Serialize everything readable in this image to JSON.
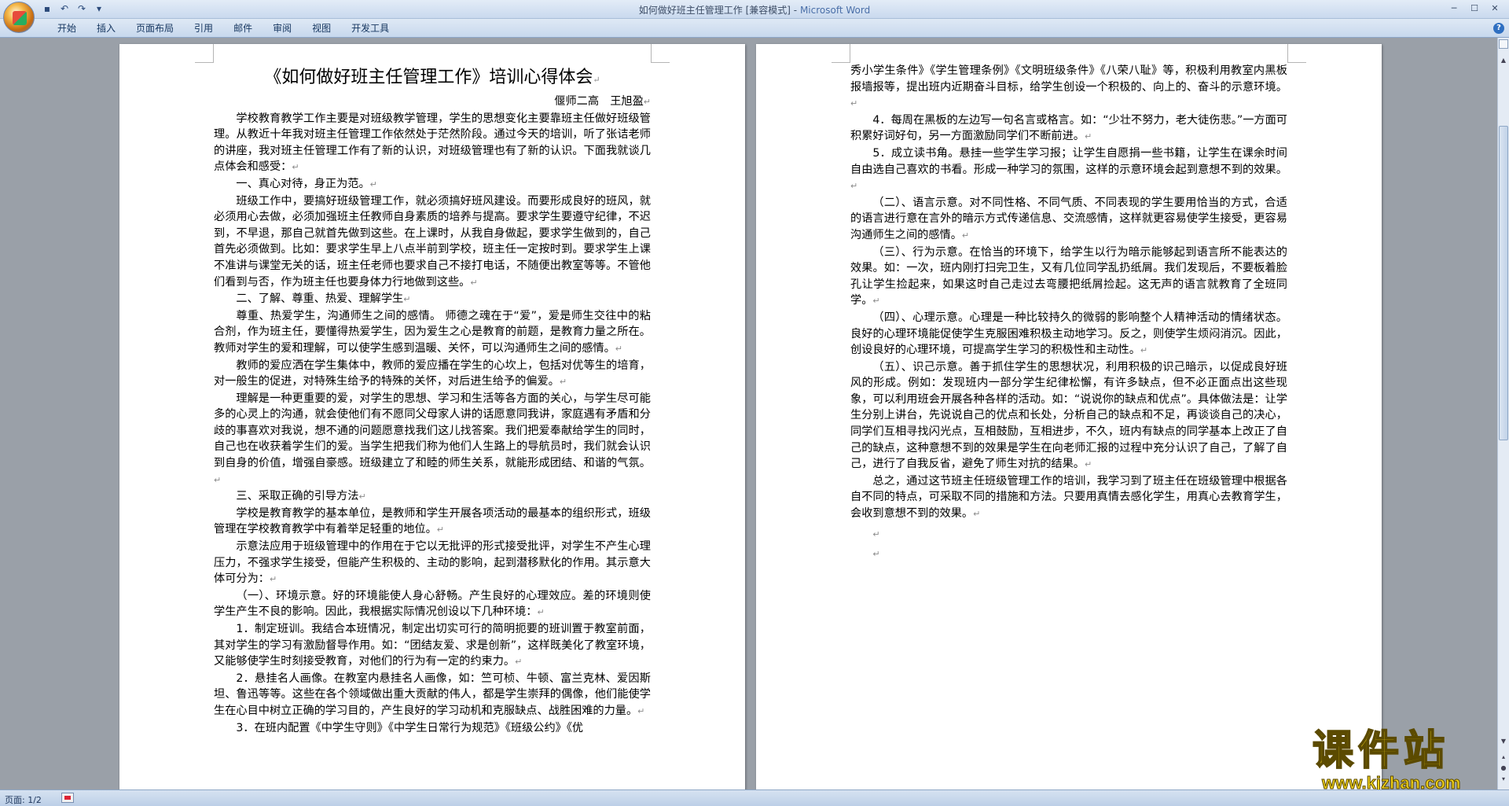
{
  "window": {
    "title": "如何做好班主任管理工作 [兼容模式]",
    "app_name": "Microsoft Word",
    "separator": " - "
  },
  "quick_access": [
    "save-icon",
    "undo-icon",
    "redo-icon",
    "customize-icon"
  ],
  "ribbon": {
    "tabs": [
      "开始",
      "插入",
      "页面布局",
      "引用",
      "邮件",
      "审阅",
      "视图",
      "开发工具"
    ]
  },
  "document": {
    "title": "《如何做好班主任管理工作》培训心得体会",
    "author": "偃师二高　王旭盈",
    "page1": [
      "学校教育教学工作主要是对班级教学管理，学生的思想变化主要靠班主任做好班级管理。从教近十年我对班主任管理工作依然处于茫然阶段。通过今天的培训，听了张诘老师的讲座，我对班主任管理工作有了新的认识，对班级管理也有了新的认识。下面我就谈几点体会和感受：",
      "一、真心对待，身正为范。",
      "班级工作中，要搞好班级管理工作，就必须搞好班风建设。而要形成良好的班风，就必须用心去做，必须加强班主任教师自身素质的培养与提高。要求学生要遵守纪律，不迟到，不早退，那自己就首先做到这些。在上课时，从我自身做起，要求学生做到的，自己首先必须做到。比如：要求学生早上八点半前到学校，班主任一定按时到。要求学生上课不准讲与课堂无关的话，班主任老师也要求自己不接打电话，不随便出教室等等。不管他们看到与否，作为班主任也要身体力行地做到这些。",
      "二、了解、尊重、热爱、理解学生",
      "尊重、热爱学生，沟通师生之间的感情。 师德之魂在于“爱”，爱是师生交往中的粘合剂，作为班主任，要懂得热爱学生，因为爱生之心是教育的前题，是教育力量之所在。教师对学生的爱和理解，可以使学生感到温暖、关怀，可以沟通师生之间的感情。",
      "教师的爱应洒在学生集体中，教师的爱应播在学生的心坎上，包括对优等生的培育，对一般生的促进，对特殊生给予的特殊的关怀，对后进生给予的偏爱。",
      "理解是一种更重要的爱，对学生的思想、学习和生活等各方面的关心，与学生尽可能多的心灵上的沟通，就会使他们有不愿同父母家人讲的话愿意同我讲，家庭遇有矛盾和分歧的事喜欢对我说，想不通的问题愿意找我们这儿找答案。我们把爱奉献给学生的同时，自己也在收获着学生们的爱。当学生把我们称为他们人生路上的导航员时，我们就会认识到自身的价值，增强自豪感。班级建立了和睦的师生关系，就能形成团结、和谐的气氛。",
      "三、采取正确的引导方法",
      "学校是教育教学的基本单位，是教师和学生开展各项活动的最基本的组织形式，班级管理在学校教育教学中有着举足轻重的地位。",
      "示意法应用于班级管理中的作用在于它以无批评的形式接受批评，对学生不产生心理压力，不强求学生接受，但能产生积极的、主动的影响，起到潜移默化的作用。其示意大体可分为：",
      "（一）、环境示意。好的环境能使人身心舒畅。产生良好的心理效应。差的环境则使学生产生不良的影响。因此，我根据实际情况创设以下几种环境：",
      "1．制定班训。我结合本班情况，制定出切实可行的简明扼要的班训置于教室前面，其对学生的学习有激励督导作用。如：“团结友爱、求是创新”，这样既美化了教室环境，又能够使学生时刻接受教育，对他们的行为有一定的约束力。",
      "2．悬挂名人画像。在教室内悬挂名人画像，如：竺可桢、牛顿、富兰克林、爱因斯坦、鲁迅等等。这些在各个领域做出重大贡献的伟人，都是学生崇拜的偶像，他们能使学生在心目中树立正确的学习目的，产生良好的学习动机和克服缺点、战胜困难的力量。",
      "3．在班内配置《中学生守则》《中学生日常行为规范》《班级公约》《优"
    ],
    "page2": [
      "秀小学生条件》《学生管理条例》《文明班级条件》《八荣八耻》等，积极利用教室内黑板报墙报等，提出班内近期奋斗目标，给学生创设一个积极的、向上的、奋斗的示意环境。",
      "4．每周在黑板的左边写一句名言或格言。如：“少壮不努力，老大徒伤悲。”一方面可积累好词好句，另一方面激励同学们不断前进。",
      "5．成立读书角。悬挂一些学生学习报；让学生自愿捐一些书籍，让学生在课余时间自由选自己喜欢的书看。形成一种学习的氛围，这样的示意环境会起到意想不到的效果。",
      "（二）、语言示意。对不同性格、不同气质、不同表现的学生要用恰当的方式，合适的语言进行意在言外的暗示方式传递信息、交流感情，这样就更容易使学生接受，更容易沟通师生之间的感情。",
      "（三）、行为示意。在恰当的环境下，给学生以行为暗示能够起到语言所不能表达的效果。如：一次，班内刚打扫完卫生，又有几位同学乱扔纸屑。我们发现后，不要板着脸孔让学生捡起来，如果这时自己走过去弯腰把纸屑捡起。这无声的语言就教育了全班同学。",
      "（四）、心理示意。心理是一种比较持久的微弱的影响整个人精神活动的情绪状态。良好的心理环境能促使学生克服困难积极主动地学习。反之，则使学生烦闷消沉。因此，创设良好的心理环境，可提高学生学习的积极性和主动性。",
      "（五）、识己示意。善于抓住学生的思想状况，利用积极的识己暗示，以促成良好班风的形成。例如：发现班内一部分学生纪律松懈，有许多缺点，但不必正面点出这些现象，可以利用班会开展各种各样的活动。如：“说说你的缺点和优点”。具体做法是：让学生分别上讲台，先说说自己的优点和长处，分析自己的缺点和不足，再谈谈自己的决心，同学们互相寻找闪光点，互相鼓励，互相进步，不久，班内有缺点的同学基本上改正了自己的缺点，这种意想不到的效果是学生在向老师汇报的过程中充分认识了自己，了解了自己，进行了自我反省，避免了师生对抗的结果。",
      "总之，通过这节班主任班级管理工作的培训，我学习到了班主任在班级管理中根据各自不同的特点，可采取不同的措施和方法。只要用真情去感化学生，用真心去教育学生，会收到意想不到的效果。"
    ],
    "paragraph_mark": "↵"
  },
  "status": {
    "page": "页面: 1/2"
  },
  "watermark": {
    "text": "课件站",
    "url": "www.kjzhan.com"
  }
}
